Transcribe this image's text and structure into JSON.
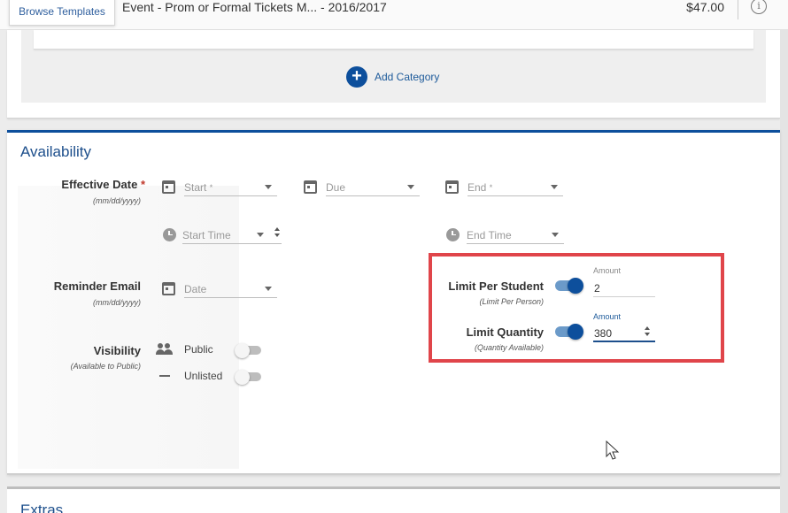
{
  "topbar": {
    "browse_templates": "Browse Templates",
    "event_title": "Event - Prom or Formal Tickets M...  - 2016/2017",
    "price": "$47.00",
    "info_icon": "info-icon"
  },
  "categories": {
    "add_category_label": "Add Category",
    "add_icon": "plus-circle-icon"
  },
  "availability": {
    "title": "Availability",
    "effective_date": {
      "label": "Effective Date",
      "required_mark": "*",
      "format": "(mm/dd/yyyy)",
      "start_placeholder": "Start",
      "start_required": "*",
      "due_placeholder": "Due",
      "end_placeholder": "End",
      "end_required": "*",
      "start_time_placeholder": "Start Time",
      "end_time_placeholder": "End Time"
    },
    "reminder_email": {
      "label": "Reminder Email",
      "format": "(mm/dd/yyyy)",
      "date_placeholder": "Date"
    },
    "visibility": {
      "label": "Visibility",
      "sub": "(Available to Public)",
      "options": [
        {
          "label": "Public",
          "icon": "people-icon",
          "on": false
        },
        {
          "label": "Unlisted",
          "icon": "dash-icon",
          "on": false
        }
      ]
    },
    "limit_per_student": {
      "label": "Limit Per Student",
      "sub": "(Limit Per Person)",
      "enabled": true,
      "amount_label": "Amount",
      "amount": "2"
    },
    "limit_quantity": {
      "label": "Limit Quantity",
      "sub": "(Quantity Available)",
      "enabled": true,
      "amount_label": "Amount",
      "amount": "380"
    }
  },
  "extras": {
    "title": "Extras"
  },
  "colors": {
    "accent": "#0d4f9c",
    "highlight_box": "#e0454a"
  }
}
